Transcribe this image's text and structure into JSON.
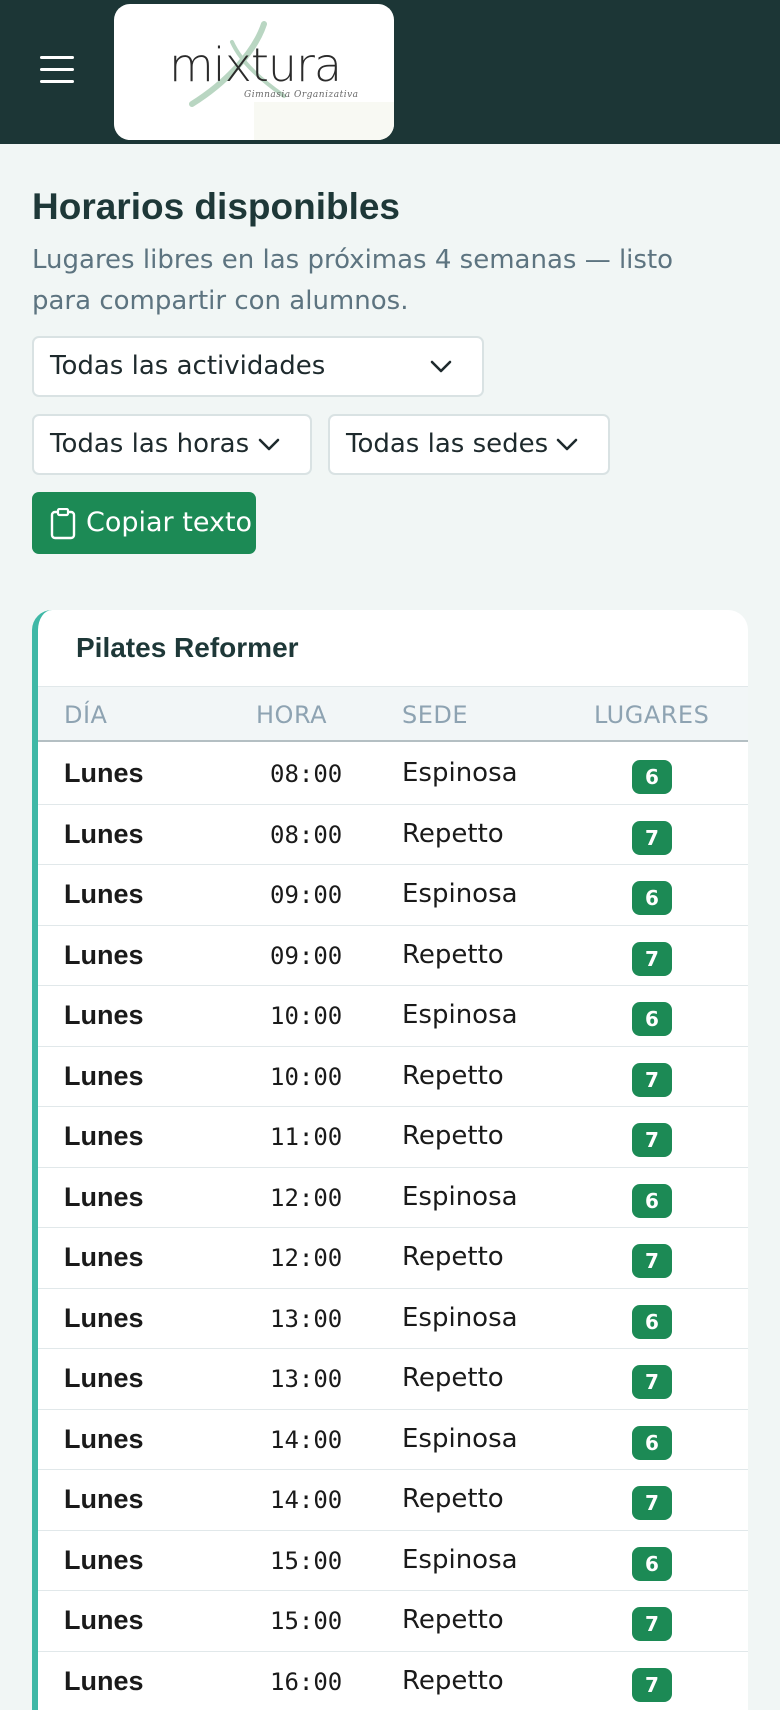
{
  "header": {
    "logo": {
      "brand": "mixtura",
      "tagline": "Gimnasia Organizativa"
    },
    "menu_icon": "hamburger-menu-icon"
  },
  "page": {
    "title": "Horarios disponibles",
    "subtitle": "Lugares libres en las próximas 4 semanas — listo para compartir con alumnos."
  },
  "filters": {
    "actividad": "Todas las actividades",
    "hora": "Todas las horas",
    "sede": "Todas las sedes"
  },
  "copy_button": {
    "label": "Copiar texto",
    "icon": "clipboard-icon"
  },
  "colors": {
    "topbar": "#1c3636",
    "accent_green": "#1c8a55",
    "card_accent": "#3fb8a6"
  },
  "table": {
    "activity": "Pilates Reformer",
    "columns": [
      "DÍA",
      "HORA",
      "SEDE",
      "LUGARES"
    ],
    "rows": [
      {
        "dia": "Lunes",
        "hora": "08:00",
        "sede": "Espinosa",
        "lugares": "6"
      },
      {
        "dia": "Lunes",
        "hora": "08:00",
        "sede": "Repetto",
        "lugares": "7"
      },
      {
        "dia": "Lunes",
        "hora": "09:00",
        "sede": "Espinosa",
        "lugares": "6"
      },
      {
        "dia": "Lunes",
        "hora": "09:00",
        "sede": "Repetto",
        "lugares": "7"
      },
      {
        "dia": "Lunes",
        "hora": "10:00",
        "sede": "Espinosa",
        "lugares": "6"
      },
      {
        "dia": "Lunes",
        "hora": "10:00",
        "sede": "Repetto",
        "lugares": "7"
      },
      {
        "dia": "Lunes",
        "hora": "11:00",
        "sede": "Repetto",
        "lugares": "7"
      },
      {
        "dia": "Lunes",
        "hora": "12:00",
        "sede": "Espinosa",
        "lugares": "6"
      },
      {
        "dia": "Lunes",
        "hora": "12:00",
        "sede": "Repetto",
        "lugares": "7"
      },
      {
        "dia": "Lunes",
        "hora": "13:00",
        "sede": "Espinosa",
        "lugares": "6"
      },
      {
        "dia": "Lunes",
        "hora": "13:00",
        "sede": "Repetto",
        "lugares": "7"
      },
      {
        "dia": "Lunes",
        "hora": "14:00",
        "sede": "Espinosa",
        "lugares": "6"
      },
      {
        "dia": "Lunes",
        "hora": "14:00",
        "sede": "Repetto",
        "lugares": "7"
      },
      {
        "dia": "Lunes",
        "hora": "15:00",
        "sede": "Espinosa",
        "lugares": "6"
      },
      {
        "dia": "Lunes",
        "hora": "15:00",
        "sede": "Repetto",
        "lugares": "7"
      },
      {
        "dia": "Lunes",
        "hora": "16:00",
        "sede": "Repetto",
        "lugares": "7"
      }
    ]
  }
}
